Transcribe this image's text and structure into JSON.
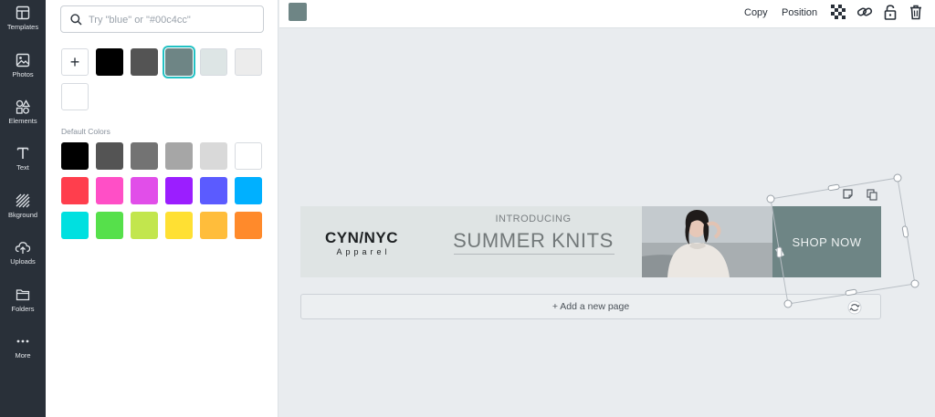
{
  "sidebar": {
    "items": [
      {
        "label": "Templates",
        "icon": "templates-icon"
      },
      {
        "label": "Photos",
        "icon": "photos-icon"
      },
      {
        "label": "Elements",
        "icon": "elements-icon"
      },
      {
        "label": "Text",
        "icon": "text-icon"
      },
      {
        "label": "Bkground",
        "icon": "background-icon"
      },
      {
        "label": "Uploads",
        "icon": "uploads-icon"
      },
      {
        "label": "Folders",
        "icon": "folders-icon"
      },
      {
        "label": "More",
        "icon": "more-icon"
      }
    ]
  },
  "search": {
    "placeholder": "Try \"blue\" or \"#00c4cc\"",
    "value": ""
  },
  "document_colors": [
    "#000000",
    "#545454",
    "#6e8585",
    "#dde5e5",
    "#ececec",
    "#ffffff"
  ],
  "selected_color": "#6e8585",
  "default_colors_label": "Default Colors",
  "default_colors": [
    "#000000",
    "#545454",
    "#737373",
    "#a6a6a6",
    "#d9d9d9",
    "#ffffff",
    "#ff3e4d",
    "#ff4fc6",
    "#e14ee9",
    "#9b1eff",
    "#5b5bff",
    "#00b0ff",
    "#00e0e0",
    "#56e04b",
    "#c2e64d",
    "#ffe033",
    "#ffbd3b",
    "#ff8a2b"
  ],
  "toolbar": {
    "copy_label": "Copy",
    "position_label": "Position",
    "icons": [
      "transparency-icon",
      "link-icon",
      "unlock-icon",
      "trash-icon"
    ]
  },
  "banner": {
    "brand_name": "CYN/NYC",
    "brand_sub": "Apparel",
    "introducing": "INTRODUCING",
    "headline": "SUMMER KNITS",
    "cta": "SHOP NOW",
    "cta_color": "#6e8585",
    "background_color": "#dfe4e4"
  },
  "add_page_label": "+ Add a new page",
  "accent_color": "#22c1c3"
}
